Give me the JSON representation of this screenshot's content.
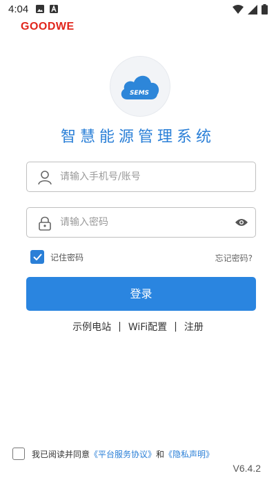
{
  "status_bar": {
    "time": "4:04",
    "left_icons": [
      "image-icon",
      "a-badge-icon"
    ],
    "right_icons": [
      "wifi-icon",
      "signal-icon",
      "battery-icon"
    ]
  },
  "brand": {
    "name": "GOODWE",
    "color": "#e1251b"
  },
  "logo": {
    "text": "SEMS"
  },
  "app_title": "智慧能源管理系统",
  "phone_field": {
    "placeholder": "请输入手机号/账号",
    "value": ""
  },
  "password_field": {
    "placeholder": "请输入密码",
    "value": ""
  },
  "remember": {
    "label": "记住密码",
    "checked": true
  },
  "forgot_label": "忘记密码?",
  "login_button": "登录",
  "links": {
    "demo": "示例电站",
    "separator": "|",
    "wifi": "WiFi配置",
    "register": "注册"
  },
  "agreement": {
    "prefix": "我已阅读并同意",
    "service": "《平台服务协议》",
    "and": "和",
    "privacy": "《隐私声明》",
    "checked": false
  },
  "version": "V6.4.2",
  "colors": {
    "accent": "#2a85e0",
    "brand": "#e1251b"
  }
}
